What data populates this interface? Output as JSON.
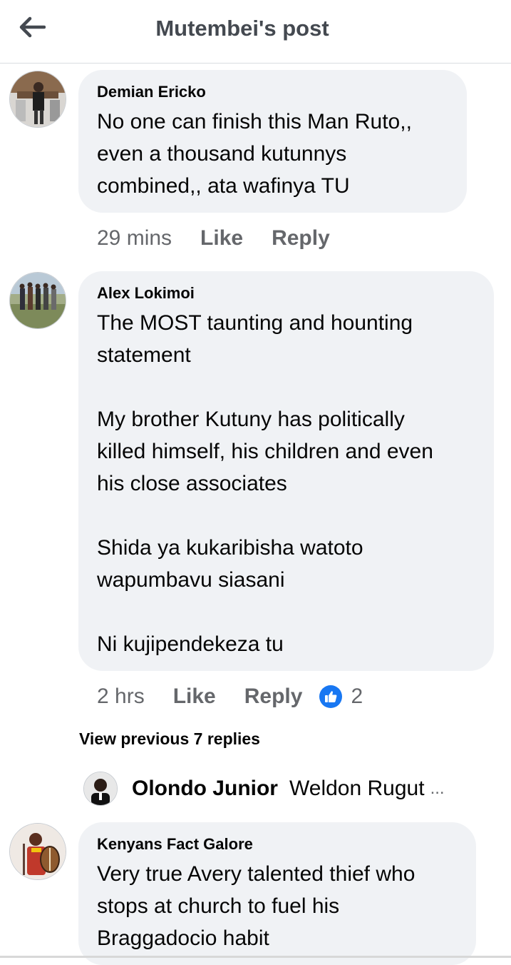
{
  "header": {
    "title": "Mutembei's post",
    "back_icon": "arrow-left-icon"
  },
  "comments": [
    {
      "author": "Demian Ericko",
      "text": "No one can finish this Man Ruto,,\neven a thousand kutunnys\ncombined,, ata wafinya TU",
      "time": "29 mins",
      "like_label": "Like",
      "reply_label": "Reply"
    },
    {
      "author": "Alex Lokimoi",
      "text": "The MOST taunting and hounting\nstatement\n\nMy brother Kutuny has politically\nkilled himself, his children and even\nhis close associates\n\nShida ya kukaribisha watoto\nwapumbavu siasani\n\nNi kujipendekeza tu",
      "time": "2 hrs",
      "like_label": "Like",
      "reply_label": "Reply",
      "reaction_icon": "like-thumb-icon",
      "reaction_count": "2"
    },
    {
      "author": "Kenyans Fact Galore",
      "text": "Very true Avery talented thief who\nstops at church to fuel his\nBraggadocio habit"
    }
  ],
  "view_previous": "View previous 7 replies",
  "reply_preview": {
    "author": "Olondo Junior",
    "text": "Weldon Rugut",
    "ellipsis": "..."
  },
  "colors": {
    "bubble": "#f0f2f5",
    "muted": "#65676b",
    "like_blue": "#1877f2"
  }
}
